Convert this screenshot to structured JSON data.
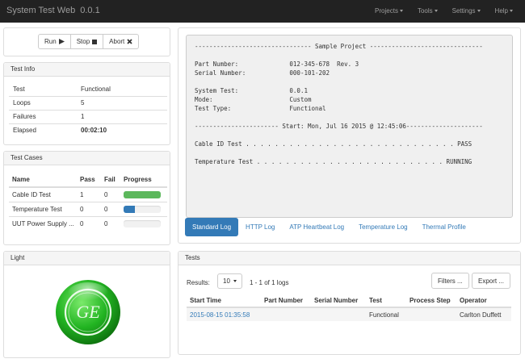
{
  "app": {
    "title": "System Test Web",
    "version": "0.0.1"
  },
  "nav": {
    "items": [
      "Projects",
      "Tools",
      "Settings",
      "Help"
    ]
  },
  "controls": {
    "run_label": "Run",
    "run_icon": "play-icon",
    "stop_label": "Stop",
    "stop_icon": "stop-icon",
    "abort_label": "Abort",
    "abort_icon": "close-icon"
  },
  "test_info": {
    "heading": "Test Info",
    "rows": [
      {
        "key": "Test",
        "value": "Functional"
      },
      {
        "key": "Loops",
        "value": "5"
      },
      {
        "key": "Failures",
        "value": "1"
      },
      {
        "key": "Elapsed",
        "value": "00:02:10"
      }
    ]
  },
  "test_cases": {
    "heading": "Test Cases",
    "columns": [
      "Name",
      "Pass",
      "Fail",
      "Progress"
    ],
    "rows": [
      {
        "name": "Cable ID Test",
        "pass": "1",
        "fail": "0",
        "progress": 1.0,
        "color": "#5cb85c"
      },
      {
        "name": "Temperature Test",
        "pass": "0",
        "fail": "0",
        "progress": 0.3,
        "color": "#337ab7"
      },
      {
        "name": "UUT Power Supply ...",
        "pass": "0",
        "fail": "0",
        "progress": 0.0,
        "color": "#337ab7"
      }
    ]
  },
  "light": {
    "heading": "Light",
    "logo": "GE",
    "color": "#22b422"
  },
  "log": {
    "lines": [
      "-------------------------------- Sample Project -------------------------------",
      "",
      "Part Number:              012-345-678  Rev. 3",
      "Serial Number:            000-101-202",
      "",
      "System Test:              0.0.1",
      "Mode:                     Custom",
      "Test Type:                Functional",
      "",
      "----------------------- Start: Mon, Jul 16 2015 @ 12:45:06---------------------",
      "",
      "Cable ID Test . . . . . . . . . . . . . . . . . . . . . . . . . . . . . PASS",
      "",
      "Temperature Test . . . . . . . . . . . . . . . . . . . . . . . . . . RUNNING"
    ],
    "tabs": [
      "Standard Log",
      "HTTP Log",
      "ATP Heartbeat Log",
      "Temperature Log",
      "Thermal Profile"
    ],
    "active_tab": 0
  },
  "tests": {
    "heading": "Tests",
    "results_label": "Results:",
    "page_size": "10",
    "count_label": "1 - 1 of 1 logs",
    "filters_label": "Filters ...",
    "export_label": "Export ...",
    "columns": [
      "Start Time",
      "Part Number",
      "Serial Number",
      "Test",
      "Process Step",
      "Operator"
    ],
    "rows": [
      [
        "2015-08-15 01:35:58",
        "",
        "",
        "Functional",
        "",
        "Carlton Duffett"
      ]
    ]
  },
  "colors": {
    "navbar": "#222222",
    "accent": "#337ab7",
    "success": "#5cb85c"
  }
}
